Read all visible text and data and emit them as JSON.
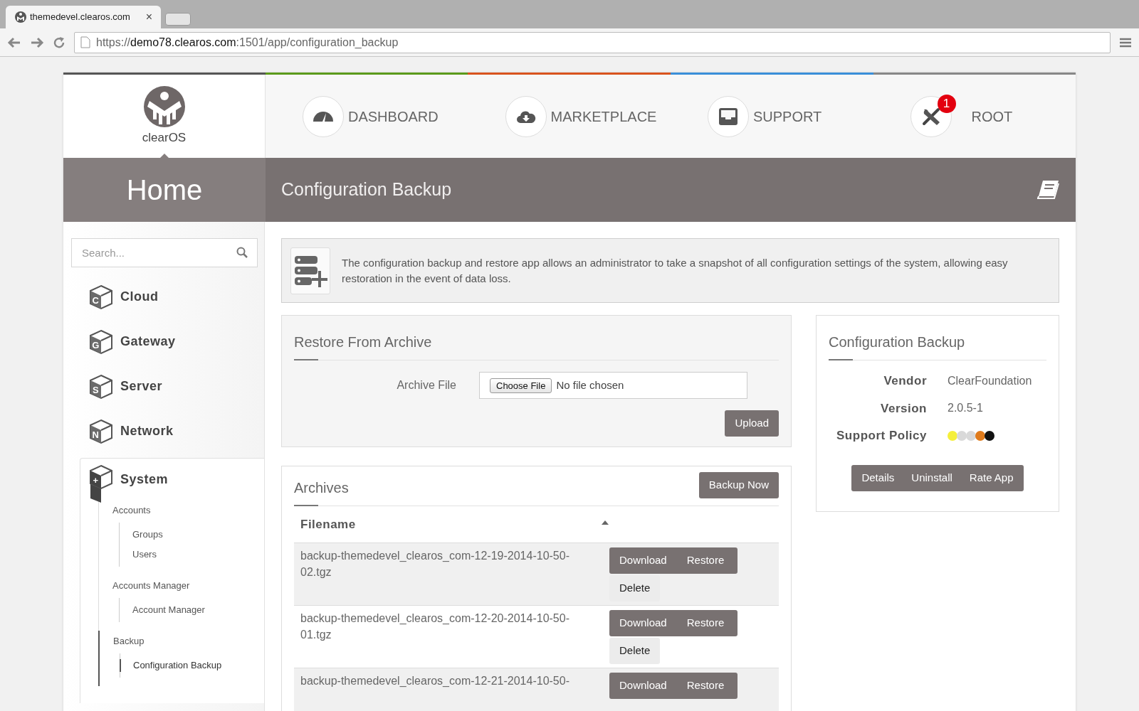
{
  "browser": {
    "tab": {
      "title": "themedevel.clearos.com",
      "close": "×"
    },
    "address": {
      "scheme": "https://",
      "host": "demo78.clearos.com",
      "path": ":1501/app/configuration_backup"
    }
  },
  "logo": {
    "text": "clearOS"
  },
  "nav": [
    {
      "label": "DASHBOARD"
    },
    {
      "label": "MARKETPLACE"
    },
    {
      "label": "SUPPORT"
    },
    {
      "label": "ROOT",
      "badge": "1"
    }
  ],
  "section_title": "Home",
  "page_title": "Configuration Backup",
  "sidebar": {
    "search": {
      "placeholder": "Search..."
    },
    "categories": [
      {
        "label": "Cloud",
        "icon_letter": "C",
        "expanded": false
      },
      {
        "label": "Gateway",
        "icon_letter": "G",
        "expanded": false
      },
      {
        "label": "Server",
        "icon_letter": "S",
        "expanded": false
      },
      {
        "label": "Network",
        "icon_letter": "N",
        "expanded": false
      },
      {
        "label": "System",
        "icon_letter": "+",
        "expanded": true,
        "children": [
          {
            "label": "Accounts",
            "children": [
              {
                "label": "Groups",
                "selected": false
              },
              {
                "label": "Users",
                "selected": false
              }
            ]
          },
          {
            "label": "Accounts Manager",
            "children": [
              {
                "label": "Account Manager",
                "selected": false
              }
            ]
          },
          {
            "label": "Backup",
            "children": [
              {
                "label": "Configuration Backup",
                "selected": true
              }
            ]
          }
        ]
      }
    ]
  },
  "intro": "The configuration backup and restore app allows an administrator to take a snapshot of all configuration settings of the system, allowing easy restoration in the event of data loss.",
  "restore": {
    "title": "Restore From Archive",
    "field_label": "Archive File",
    "choose_button": "Choose File",
    "file_status": "No file chosen",
    "upload_button": "Upload"
  },
  "archives": {
    "title": "Archives",
    "backup_button": "Backup Now",
    "columns": [
      {
        "label": "Filename"
      }
    ],
    "rows": [
      {
        "filename": "backup-themedevel_clearos_com-12-19-2014-10-50-02.tgz",
        "actions": [
          "Download",
          "Restore"
        ],
        "delete": "Delete"
      },
      {
        "filename": "backup-themedevel_clearos_com-12-20-2014-10-50-01.tgz",
        "actions": [
          "Download",
          "Restore"
        ],
        "delete": "Delete"
      },
      {
        "filename": "backup-themedevel_clearos_com-12-21-2014-10-50-",
        "actions": [
          "Download",
          "Restore"
        ]
      }
    ]
  },
  "app_info": {
    "title": "Configuration Backup",
    "properties": [
      {
        "label": "Vendor",
        "value": "ClearFoundation"
      },
      {
        "label": "Version",
        "value": "2.0.5-1"
      }
    ],
    "support_policy": {
      "label": "Support Policy",
      "dots": [
        {
          "color": "#f5ef3a"
        },
        {
          "color": "#d9d9d9"
        },
        {
          "color": "#d9d9d9"
        },
        {
          "color": "#e07b1c"
        },
        {
          "color": "#111111"
        }
      ]
    },
    "buttons": [
      "Details",
      "Uninstall",
      "Rate App"
    ]
  }
}
